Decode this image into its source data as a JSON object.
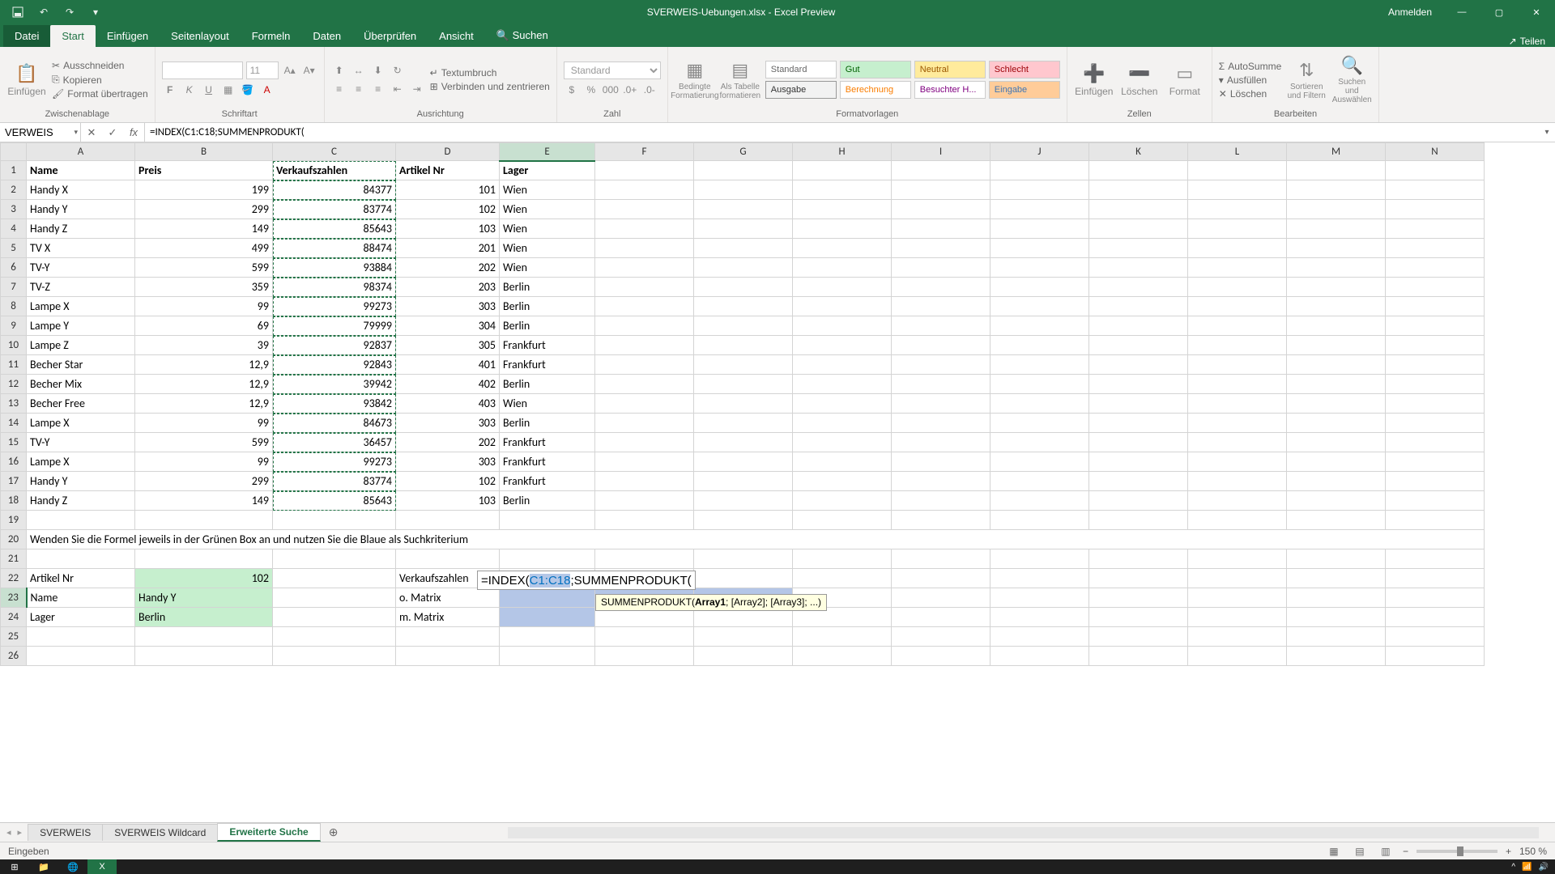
{
  "title": "SVERWEIS-Uebungen.xlsx - Excel Preview",
  "titlebar_right": {
    "signin": "Anmelden"
  },
  "tabs": {
    "file": "Datei",
    "home": "Start",
    "insert": "Einfügen",
    "pagelayout": "Seitenlayout",
    "formulas": "Formeln",
    "data": "Daten",
    "review": "Überprüfen",
    "view": "Ansicht",
    "search": "Suchen",
    "share": "Teilen"
  },
  "ribbon": {
    "clipboard": {
      "paste": "Einfügen",
      "cut": "Ausschneiden",
      "copy": "Kopieren",
      "format_painter": "Format übertragen",
      "group": "Zwischenablage"
    },
    "font": {
      "size": "11",
      "group": "Schriftart"
    },
    "alignment": {
      "wrap": "Textumbruch",
      "merge": "Verbinden und zentrieren",
      "group": "Ausrichtung"
    },
    "number": {
      "format": "Standard",
      "group": "Zahl"
    },
    "styles": {
      "cond": "Bedingte Formatierung",
      "table": "Als Tabelle formatieren",
      "standard": "Standard",
      "gut": "Gut",
      "neutral": "Neutral",
      "schlecht": "Schlecht",
      "ausgabe": "Ausgabe",
      "berechnung": "Berechnung",
      "besuchter": "Besuchter H...",
      "eingabe": "Eingabe",
      "group": "Formatvorlagen"
    },
    "cells": {
      "insert": "Einfügen",
      "delete": "Löschen",
      "format": "Format",
      "group": "Zellen"
    },
    "editing": {
      "sum": "AutoSumme",
      "fill": "Ausfüllen",
      "clear": "Löschen",
      "sort": "Sortieren und Filtern",
      "find": "Suchen und Auswählen",
      "group": "Bearbeiten"
    }
  },
  "name_box": "VERWEIS",
  "formula_bar": "=INDEX(C1:C18;SUMMENPRODUKT(",
  "columns": [
    "A",
    "B",
    "C",
    "D",
    "E",
    "F",
    "G",
    "H",
    "I",
    "J",
    "K",
    "L",
    "M",
    "N"
  ],
  "row_headers": [
    "1",
    "2",
    "3",
    "4",
    "5",
    "6",
    "7",
    "8",
    "9",
    "10",
    "11",
    "12",
    "13",
    "14",
    "15",
    "16",
    "17",
    "18",
    "19",
    "20",
    "21",
    "22",
    "23",
    "24",
    "25",
    "26"
  ],
  "headers": {
    "name": "Name",
    "preis": "Preis",
    "verkauf": "Verkaufszahlen",
    "artikel": "Artikel Nr",
    "lager": "Lager"
  },
  "rows": [
    {
      "name": "Handy X",
      "preis": "199",
      "verkauf": "84377",
      "artikel": "101",
      "lager": "Wien"
    },
    {
      "name": "Handy Y",
      "preis": "299",
      "verkauf": "83774",
      "artikel": "102",
      "lager": "Wien"
    },
    {
      "name": "Handy Z",
      "preis": "149",
      "verkauf": "85643",
      "artikel": "103",
      "lager": "Wien"
    },
    {
      "name": "TV X",
      "preis": "499",
      "verkauf": "88474",
      "artikel": "201",
      "lager": "Wien"
    },
    {
      "name": "TV-Y",
      "preis": "599",
      "verkauf": "93884",
      "artikel": "202",
      "lager": "Wien"
    },
    {
      "name": "TV-Z",
      "preis": "359",
      "verkauf": "98374",
      "artikel": "203",
      "lager": "Berlin"
    },
    {
      "name": "Lampe X",
      "preis": "99",
      "verkauf": "99273",
      "artikel": "303",
      "lager": "Berlin"
    },
    {
      "name": "Lampe Y",
      "preis": "69",
      "verkauf": "79999",
      "artikel": "304",
      "lager": "Berlin"
    },
    {
      "name": "Lampe Z",
      "preis": "39",
      "verkauf": "92837",
      "artikel": "305",
      "lager": "Frankfurt"
    },
    {
      "name": "Becher Star",
      "preis": "12,9",
      "verkauf": "92843",
      "artikel": "401",
      "lager": "Frankfurt"
    },
    {
      "name": "Becher Mix",
      "preis": "12,9",
      "verkauf": "39942",
      "artikel": "402",
      "lager": "Berlin"
    },
    {
      "name": "Becher Free",
      "preis": "12,9",
      "verkauf": "93842",
      "artikel": "403",
      "lager": "Wien"
    },
    {
      "name": "Lampe X",
      "preis": "99",
      "verkauf": "84673",
      "artikel": "303",
      "lager": "Berlin"
    },
    {
      "name": "TV-Y",
      "preis": "599",
      "verkauf": "36457",
      "artikel": "202",
      "lager": "Frankfurt"
    },
    {
      "name": "Lampe X",
      "preis": "99",
      "verkauf": "99273",
      "artikel": "303",
      "lager": "Frankfurt"
    },
    {
      "name": "Handy Y",
      "preis": "299",
      "verkauf": "83774",
      "artikel": "102",
      "lager": "Frankfurt"
    },
    {
      "name": "Handy Z",
      "preis": "149",
      "verkauf": "85643",
      "artikel": "103",
      "lager": "Berlin"
    }
  ],
  "instruction": "Wenden Sie die Formel jeweils in der Grünen Box an und nutzen Sie die Blaue als Suchkriterium",
  "lookup": {
    "artikel_lbl": "Artikel Nr",
    "artikel_val": "102",
    "name_lbl": "Name",
    "name_val": "Handy Y",
    "lager_lbl": "Lager",
    "lager_val": "Berlin",
    "verkauf_lbl": "Verkaufszahlen",
    "o_matrix": "o. Matrix",
    "m_matrix": "m. Matrix"
  },
  "cell_edit": {
    "prefix": "=INDEX(",
    "ref": "C1:C18",
    "suffix": ";SUMMENPRODUKT("
  },
  "tooltip": {
    "fn": "SUMMENPRODUKT(",
    "arg1": "Array1",
    "rest": "; [Array2]; [Array3]; ...)"
  },
  "sheet_tabs": {
    "t1": "SVERWEIS",
    "t2": "SVERWEIS Wildcard",
    "t3": "Erweiterte Suche"
  },
  "status": {
    "mode": "Eingeben",
    "zoom": "150 %"
  }
}
